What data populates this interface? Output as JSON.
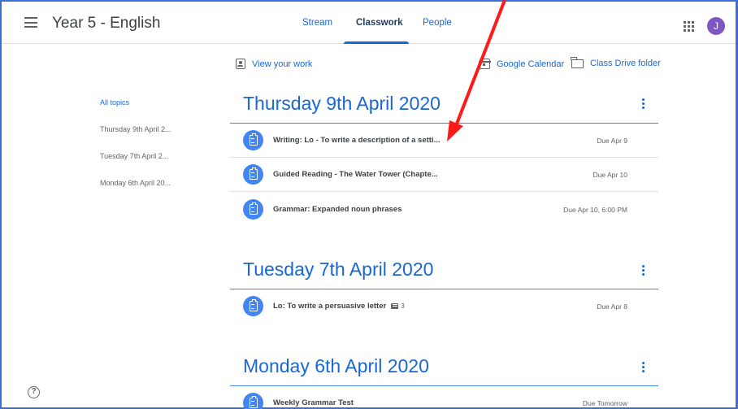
{
  "header": {
    "title": "Year 5 - English",
    "tabs": [
      {
        "label": "Stream"
      },
      {
        "label": "Classwork"
      },
      {
        "label": "People"
      }
    ],
    "avatar_initial": "J"
  },
  "toolbar": {
    "view_work": "View your work",
    "calendar": "Google Calendar",
    "drive": "Class Drive folder"
  },
  "sidebar": {
    "items": [
      {
        "label": "All topics"
      },
      {
        "label": "Thursday 9th April 2..."
      },
      {
        "label": "Tuesday 7th April 2..."
      },
      {
        "label": "Monday 6th April 20..."
      }
    ]
  },
  "sections": [
    {
      "title": "Thursday 9th April 2020",
      "assignments": [
        {
          "title": "Writing: Lo - To write a description of a setti...",
          "due": "Due Apr 9"
        },
        {
          "title": "Guided Reading - The Water Tower (Chapte...",
          "due": "Due Apr 10"
        },
        {
          "title": "Grammar: Expanded noun phrases",
          "due": "Due Apr 10, 6:00 PM"
        }
      ]
    },
    {
      "title": "Tuesday 7th April 2020",
      "assignments": [
        {
          "title": "Lo: To write a persuasive letter",
          "comments": "3",
          "due": "Due Apr 8"
        }
      ]
    },
    {
      "title": "Monday 6th April 2020",
      "assignments": [
        {
          "title": "Weekly Grammar Test",
          "due": "Due Tomorrow"
        }
      ]
    }
  ],
  "colors": {
    "accent": "#1967d2",
    "assignment_icon": "#4285f4",
    "avatar": "#7e57c2",
    "annotation_arrow": "#ff0000",
    "frame": "#3b6fd8"
  },
  "icons": [
    "menu-icon",
    "apps-icon",
    "person-icon",
    "calendar-icon",
    "folder-icon",
    "assignment-icon",
    "comment-icon",
    "kebab-icon",
    "help-icon"
  ]
}
